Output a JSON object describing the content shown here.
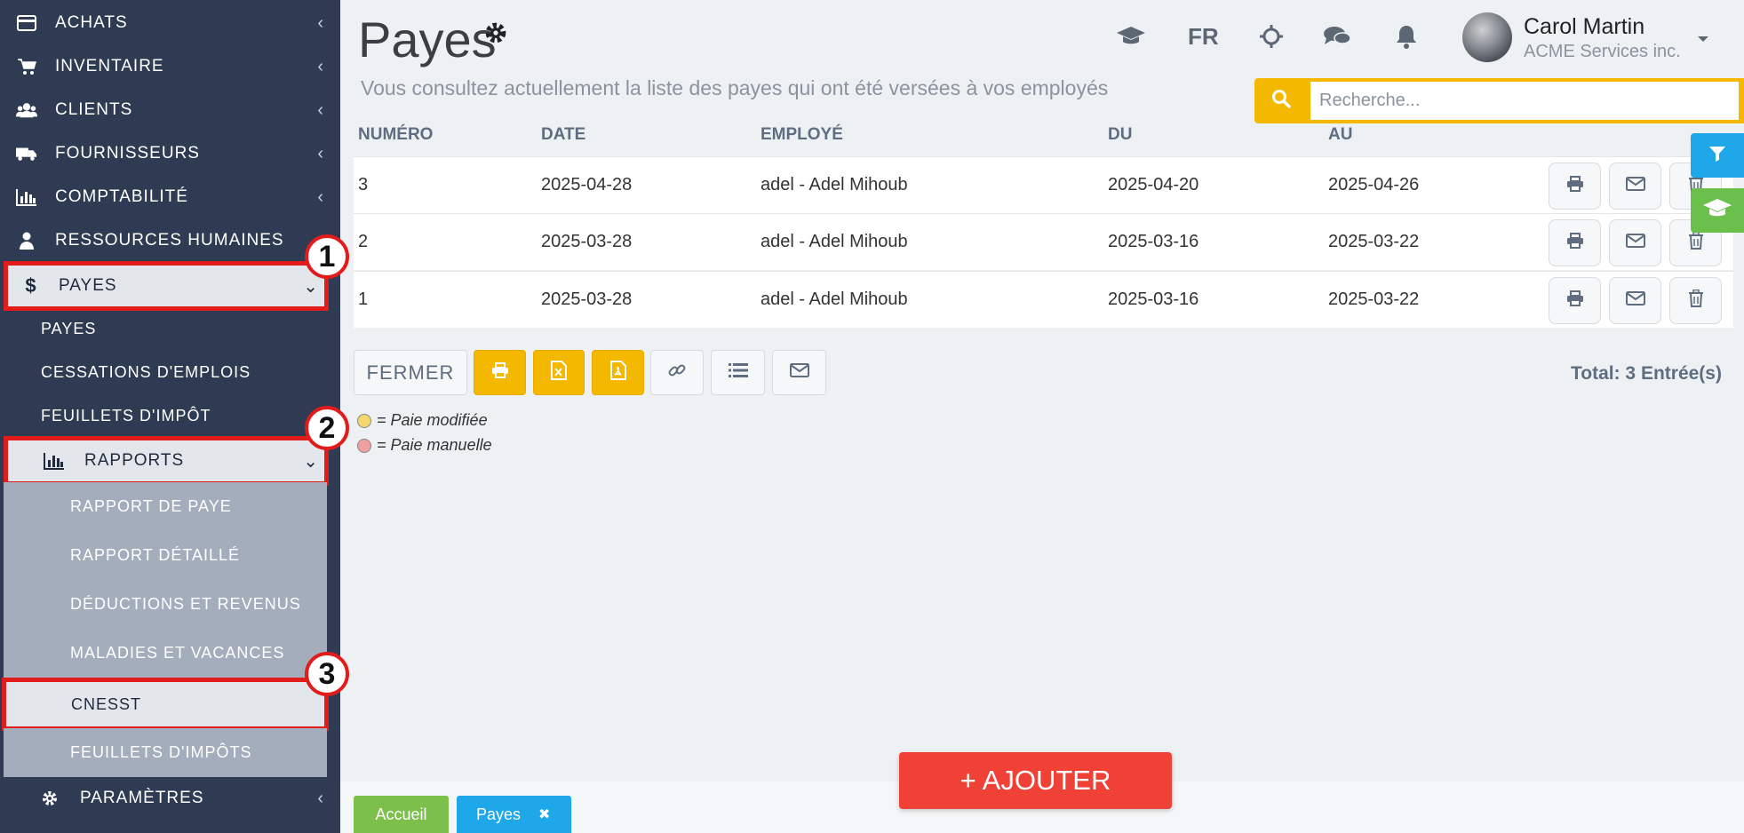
{
  "sidebar": {
    "items": [
      {
        "label": "ACHATS",
        "icon": "credit-card-icon"
      },
      {
        "label": "INVENTAIRE",
        "icon": "cart-icon"
      },
      {
        "label": "CLIENTS",
        "icon": "users-icon"
      },
      {
        "label": "FOURNISSEURS",
        "icon": "truck-icon"
      },
      {
        "label": "COMPTABILITÉ",
        "icon": "bar-chart-icon"
      },
      {
        "label": "RESSOURCES HUMAINES",
        "icon": "user-icon"
      },
      {
        "label": "PAYES",
        "icon": "dollar-icon",
        "chevron": "⌄"
      }
    ],
    "payes_sub": [
      "PAYES",
      "CESSATIONS D'EMPLOIS",
      "FEUILLETS D'IMPÔT"
    ],
    "rapports": {
      "label": "RAPPORTS",
      "icon": "bar-chart-icon",
      "chevron": "⌄"
    },
    "rapports_sub": [
      "RAPPORT DE PAYE",
      "RAPPORT DÉTAILLÉ",
      "DÉDUCTIONS ET REVENUS",
      "MALADIES ET VACANCES",
      "CNESST",
      "FEUILLETS D'IMPÔTS"
    ],
    "parametres": {
      "label": "PARAMÈTRES",
      "icon": "gear-icon"
    },
    "chevron": "‹"
  },
  "markers": [
    "1",
    "2",
    "3"
  ],
  "header": {
    "title": "Payes",
    "subtitle": "Vous consultez actuellement la liste des payes qui ont été versées à vos employés",
    "lang": "FR",
    "user_name": "Carol Martin",
    "user_company": "ACME Services inc."
  },
  "search": {
    "placeholder": "Recherche..."
  },
  "table": {
    "columns": [
      "NUMÉRO",
      "DATE",
      "EMPLOYÉ",
      "DU",
      "AU"
    ],
    "rows": [
      [
        "3",
        "2025-04-28",
        "adel - Adel Mihoub",
        "2025-04-20",
        "2025-04-26"
      ],
      [
        "2",
        "2025-03-28",
        "adel - Adel Mihoub",
        "2025-03-16",
        "2025-03-22"
      ],
      [
        "1",
        "2025-03-28",
        "adel - Adel Mihoub",
        "2025-03-16",
        "2025-03-22"
      ]
    ]
  },
  "toolbar": {
    "close_label": "FERMER",
    "total": "Total: 3 Entrée(s)"
  },
  "legend": [
    {
      "label": "= Paie modifiée",
      "color": "#f5d76e"
    },
    {
      "label": "= Paie manuelle",
      "color": "#f0a0a0"
    }
  ],
  "add_button": "+ AJOUTER",
  "tabs": [
    {
      "label": "Accueil",
      "color": "#7cc04b"
    },
    {
      "label": "Payes",
      "color": "#1ea7e9",
      "close": "✖"
    }
  ],
  "colors": {
    "sidebar": "#2e3b52",
    "accent": "#f5b800",
    "danger": "#ef4136",
    "highlight": "#e21b1b"
  }
}
